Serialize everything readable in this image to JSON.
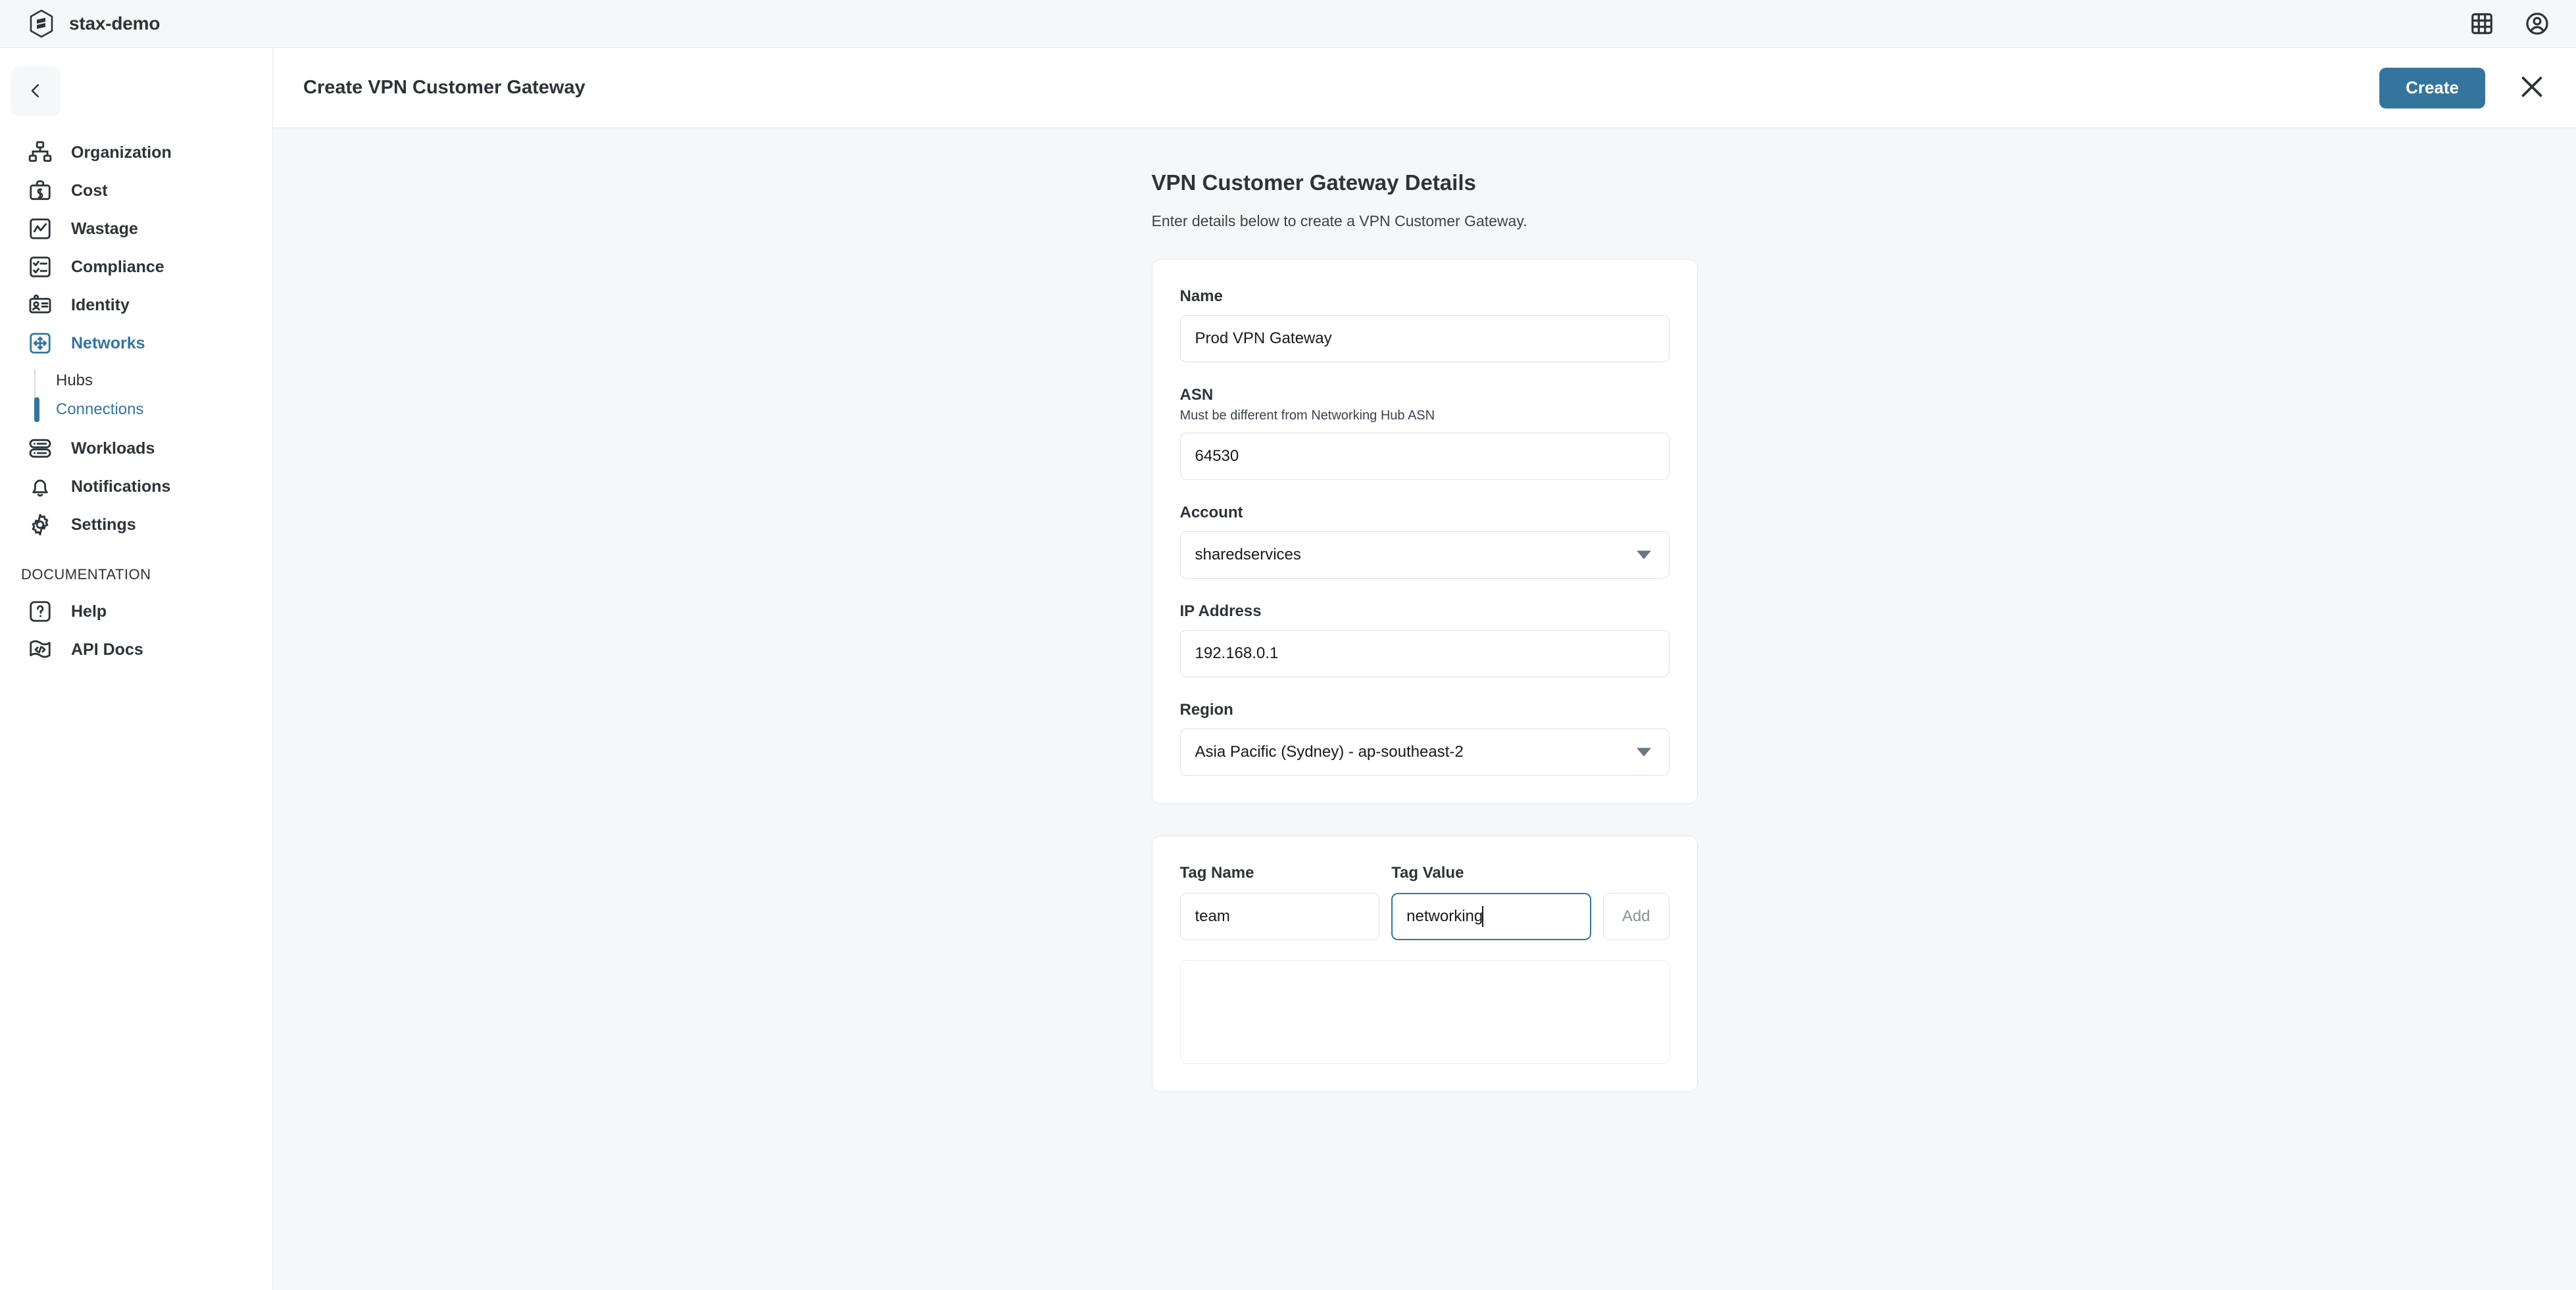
{
  "topbar": {
    "brand_name": "stax-demo",
    "logo_icon": "stax-hexagon-logo-icon",
    "apps_icon": "grid-apps-icon",
    "account_icon": "user-account-circle-icon"
  },
  "sidebar": {
    "back_icon": "chevron-left-icon",
    "items": [
      {
        "label": "Organization",
        "icon": "org-chart-icon",
        "active": false
      },
      {
        "label": "Cost",
        "icon": "briefcase-dollar-icon",
        "active": false
      },
      {
        "label": "Wastage",
        "icon": "chart-line-box-icon",
        "active": false
      },
      {
        "label": "Compliance",
        "icon": "checklist-box-icon",
        "active": false
      },
      {
        "label": "Identity",
        "icon": "id-badge-icon",
        "active": false
      },
      {
        "label": "Networks",
        "icon": "network-move-arrows-icon",
        "active": true
      }
    ],
    "subitems": [
      {
        "label": "Hubs",
        "active": false
      },
      {
        "label": "Connections",
        "active": true
      }
    ],
    "items_after": [
      {
        "label": "Workloads",
        "icon": "server-stack-icon",
        "active": false
      },
      {
        "label": "Notifications",
        "icon": "bell-icon",
        "active": false
      },
      {
        "label": "Settings",
        "icon": "gear-icon",
        "active": false
      }
    ],
    "section_title": "DOCUMENTATION",
    "doc_items": [
      {
        "label": "Help",
        "icon": "question-mark-box-icon",
        "active": false
      },
      {
        "label": "API Docs",
        "icon": "code-flag-icon",
        "active": false
      }
    ]
  },
  "panel": {
    "title": "Create VPN Customer Gateway",
    "create_label": "Create",
    "close_icon": "close-x-icon"
  },
  "form": {
    "title": "VPN Customer Gateway Details",
    "subtitle": "Enter details below to create a VPN Customer Gateway.",
    "name": {
      "label": "Name",
      "value": "Prod VPN Gateway",
      "placeholder": ""
    },
    "asn": {
      "label": "ASN",
      "hint": "Must be different from Networking Hub ASN",
      "value": "64530",
      "placeholder": ""
    },
    "account": {
      "label": "Account",
      "value": "sharedservices"
    },
    "ip_address": {
      "label": "IP Address",
      "value": "192.168.0.1",
      "placeholder": ""
    },
    "region": {
      "label": "Region",
      "value": "Asia Pacific (Sydney) - ap-southeast-2"
    }
  },
  "tags": {
    "name_label": "Tag Name",
    "value_label": "Tag Value",
    "name_value": "team",
    "value_value": "networking",
    "add_label": "Add",
    "added": []
  },
  "colors": {
    "accent": "#35759d",
    "panel_bg": "#f5f7f8",
    "card_bg": "#ffffff",
    "text": "#2e3338",
    "border": "#e6e9eb"
  }
}
